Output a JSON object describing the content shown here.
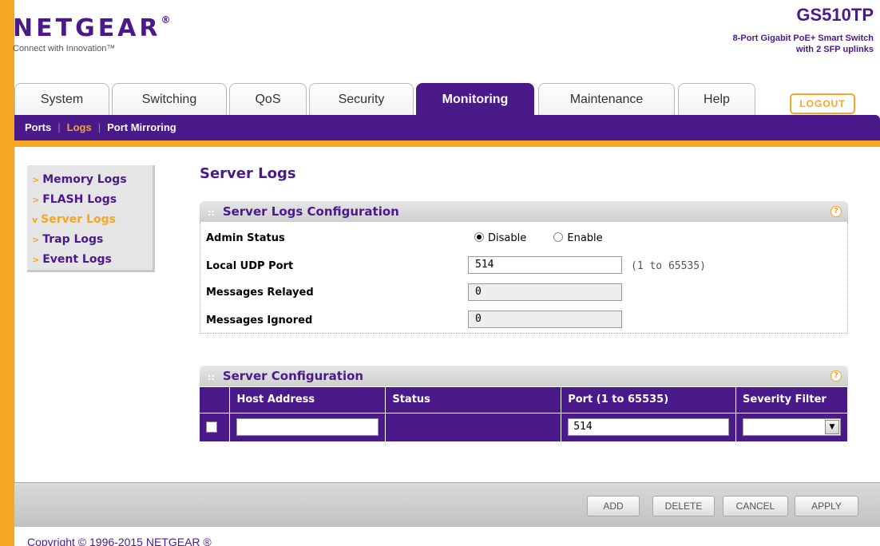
{
  "header": {
    "logo": "NETGEAR",
    "logo_mark": "®",
    "tagline": "Connect with Innovation™",
    "model": "GS510TP",
    "model_desc_line1": "8-Port Gigabit PoE+ Smart Switch",
    "model_desc_line2": "with 2 SFP uplinks"
  },
  "tabs": [
    "System",
    "Switching",
    "QoS",
    "Security",
    "Monitoring",
    "Maintenance",
    "Help"
  ],
  "active_tab": "Monitoring",
  "logout_label": "LOGOUT",
  "subnav": [
    "Ports",
    "Logs",
    "Port Mirroring"
  ],
  "active_subnav": "Logs",
  "leftmenu": [
    "Memory Logs",
    "FLASH Logs",
    "Server Logs",
    "Trap Logs",
    "Event Logs"
  ],
  "active_leftmenu": "Server Logs",
  "page_title": "Server Logs",
  "logs_config": {
    "title": "Server Logs Configuration",
    "admin_status_label": "Admin Status",
    "disable_label": "Disable",
    "enable_label": "Enable",
    "admin_status": "Disable",
    "udp_port_label": "Local UDP Port",
    "udp_port_value": "514",
    "udp_port_hint": "(1 to 65535)",
    "relayed_label": "Messages Relayed",
    "relayed_value": "0",
    "ignored_label": "Messages Ignored",
    "ignored_value": "0"
  },
  "server_config": {
    "title": "Server Configuration",
    "columns": [
      "Host Address",
      "Status",
      "Port (1 to 65535)",
      "Severity Filter"
    ],
    "row": {
      "host": "",
      "status": "",
      "port": "514",
      "severity": ""
    }
  },
  "buttons": {
    "add": "ADD",
    "delete": "DELETE",
    "cancel": "CANCEL",
    "apply": "APPLY"
  },
  "copyright": "Copyright © 1996-2015 NETGEAR ®"
}
